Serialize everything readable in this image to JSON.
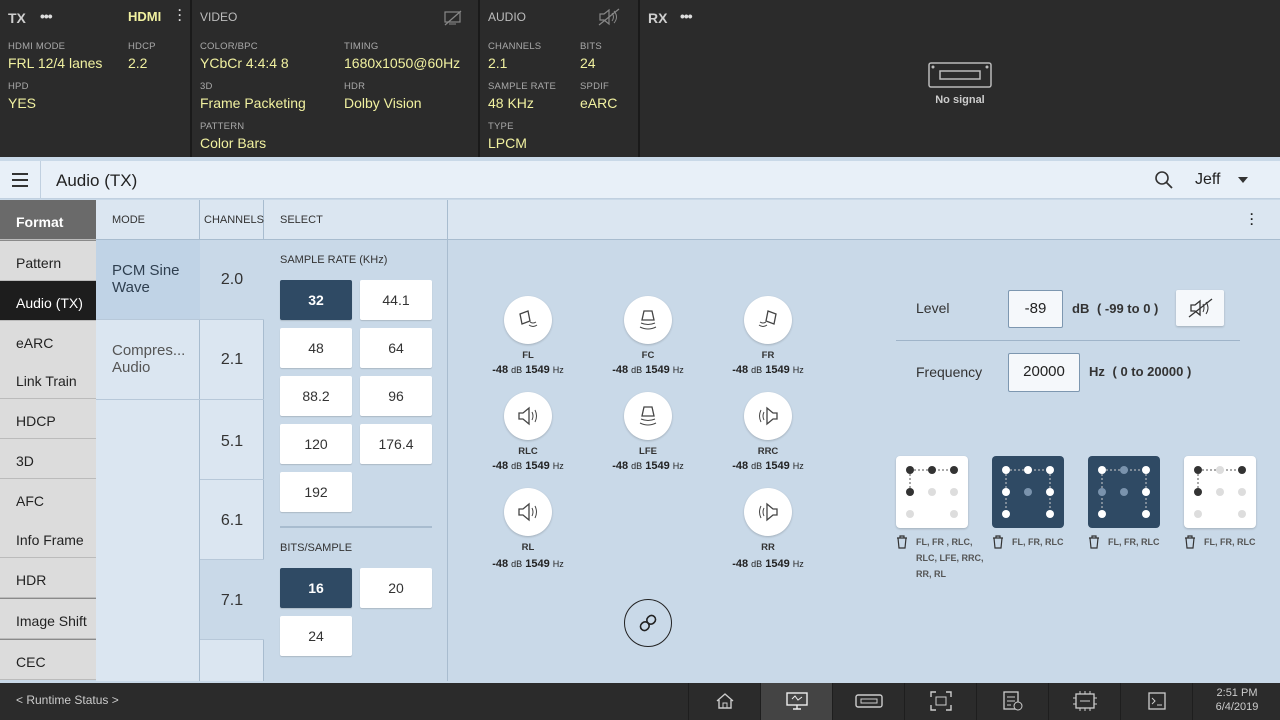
{
  "status": {
    "tx": {
      "title": "TX",
      "hdmi": "HDMI",
      "fields": [
        {
          "label": "HDMI MODE",
          "value": "FRL 12/4 lanes"
        },
        {
          "label": "HDCP",
          "value": "2.2"
        },
        {
          "label": "HPD",
          "value": "YES"
        }
      ]
    },
    "video": {
      "title": "VIDEO",
      "fields": [
        {
          "label": "COLOR/BPC",
          "value": "YCbCr  4:4:4  8"
        },
        {
          "label": "TIMING",
          "value": "1680x1050@60Hz"
        },
        {
          "label": "3D",
          "value": "Frame Packeting"
        },
        {
          "label": "HDR",
          "value": "Dolby Vision"
        },
        {
          "label": "PATTERN",
          "value": "Color Bars"
        }
      ]
    },
    "audio": {
      "title": "AUDIO",
      "fields": [
        {
          "label": "CHANNELS",
          "value": "2.1"
        },
        {
          "label": "BITS",
          "value": "24"
        },
        {
          "label": "SAMPLE RATE",
          "value": "48 KHz"
        },
        {
          "label": "SPDIF",
          "value": "eARC"
        },
        {
          "label": "TYPE",
          "value": "LPCM"
        }
      ]
    },
    "rx": {
      "title": "RX",
      "no_signal": "No signal"
    }
  },
  "appbar": {
    "title": "Audio (TX)",
    "user": "Jeff"
  },
  "sidebar": {
    "header": "Format",
    "items": [
      "Pattern",
      "Audio (TX)",
      "eARC",
      "Link Train",
      "HDCP",
      "3D",
      "AFC",
      "Info Frame",
      "HDR",
      "Image Shift",
      "CEC"
    ],
    "active": "Audio (TX)"
  },
  "columns": {
    "mode": "MODE",
    "channels": "CHANNELS",
    "select": "SELECT"
  },
  "modes": [
    "PCM Sine Wave",
    "Compres... Audio"
  ],
  "channels": [
    "2.0",
    "2.1",
    "5.1",
    "6.1",
    "7.1"
  ],
  "sample_rate": {
    "label": "SAMPLE RATE (KHz)",
    "options": [
      "32",
      "44.1",
      "48",
      "64",
      "88.2",
      "96",
      "120",
      "176.4",
      "192"
    ],
    "selected": "32"
  },
  "bits": {
    "label": "BITS/SAMPLE",
    "options": [
      "16",
      "20",
      "24"
    ],
    "selected": "16"
  },
  "speakers": [
    {
      "name": "FL",
      "db": "-48",
      "hz": "1549",
      "icon": "speaker-angled-left-icon"
    },
    {
      "name": "FC",
      "db": "-48",
      "hz": "1549",
      "icon": "speaker-center-icon"
    },
    {
      "name": "FR",
      "db": "-48",
      "hz": "1549",
      "icon": "speaker-angled-right-icon"
    },
    {
      "name": "RLC",
      "db": "-48",
      "hz": "1549",
      "icon": "speaker-right-facing-icon"
    },
    {
      "name": "LFE",
      "db": "-48",
      "hz": "1549",
      "icon": "subwoofer-icon"
    },
    {
      "name": "RRC",
      "db": "-48",
      "hz": "1549",
      "icon": "speaker-left-facing-icon"
    },
    {
      "name": "RL",
      "db": "-48",
      "hz": "1549",
      "icon": "speaker-right-facing-icon"
    },
    {
      "name": "RR",
      "db": "-48",
      "hz": "1549",
      "icon": "speaker-left-facing-icon"
    }
  ],
  "units": {
    "db": "dB",
    "hz": "Hz"
  },
  "level": {
    "label": "Level",
    "value": "-89",
    "unit": "dB",
    "range": "( -99 to 0 )"
  },
  "frequency": {
    "label": "Frequency",
    "value": "20000",
    "unit": "Hz",
    "range": "( 0 to 20000 )"
  },
  "presets": [
    {
      "label": "FL, FR , RLC, RLC, LFE, RRC, RR, RL",
      "style": "light"
    },
    {
      "label": "FL, FR, RLC",
      "style": "dark"
    },
    {
      "label": "FL, FR, RLC",
      "style": "dark"
    },
    {
      "label": "FL, FR, RLC",
      "style": "light"
    }
  ],
  "footer": {
    "runtime": "< Runtime Status >",
    "time": "2:51 PM",
    "date": "6/4/2019"
  },
  "nav": [
    "home-icon",
    "monitor-icon",
    "hdmi-port-icon",
    "capture-icon",
    "checklist-icon",
    "network-icon",
    "terminal-icon"
  ],
  "colors": {
    "accent": "#2f4a64",
    "status_value": "#f1f1a0",
    "panel_bg": "#c9d9e8"
  }
}
